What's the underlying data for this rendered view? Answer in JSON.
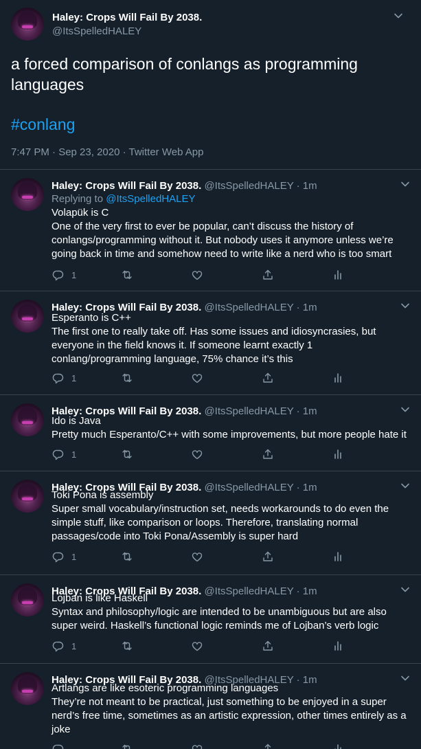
{
  "main_tweet": {
    "name": "Haley: Crops Will Fail By 2038.",
    "handle": "@ItsSpelledHALEY",
    "text": "a forced comparison of conlangs as programming languages",
    "hashtag": "#conlang",
    "meta": "7:47 PM · Sep 23, 2020 · Twitter Web App"
  },
  "replies": [
    {
      "name": "Haley: Crops Will Fail By 2038.",
      "meta": "@ItsSpelledHALEY · 1m",
      "replying_prefix": "Replying to ",
      "replying_to": "@ItsSpelledHALEY",
      "line1": "Volapük is C",
      "line2": "One of the very first to ever be popular, can’t discuss the history of conlangs/programming without it. But nobody uses it anymore unless we’re going back in time and somehow need to write like a nerd who is too smart",
      "reply_count": "1"
    },
    {
      "name": "Haley: Crops Will Fail By 2038.",
      "meta": "@ItsSpelledHALEY · 1m",
      "line1": "Esperanto is C++",
      "line2": "The first one to really take off. Has some issues and idiosyncrasies, but everyone in the field knows it. If someone learnt exactly 1 conlang/programming language, 75% chance it’s this",
      "reply_count": "1"
    },
    {
      "name": "Haley: Crops Will Fail By 2038.",
      "meta": "@ItsSpelledHALEY · 1m",
      "line1": "Ido is Java",
      "line2": "Pretty much Esperanto/C++ with some improvements, but more people hate it",
      "reply_count": "1"
    },
    {
      "name": "Haley: Crops Will Fail By 2038.",
      "meta": "@ItsSpelledHALEY · 1m",
      "line1": "Toki Pona is assembly",
      "line2": "Super small vocabulary/instruction set, needs workarounds to do even the simple stuff, like comparison or loops. Therefore, translating normal passages/code into Toki Pona/Assembly is super hard",
      "reply_count": "1"
    },
    {
      "name": "Haley: Crops Will Fail By 2038.",
      "meta": "@ItsSpelledHALEY · 1m",
      "line1": "Lojban is like Haskell",
      "line2": "Syntax and philosophy/logic are intended to be unambiguous but are also super weird. Haskell’s functional logic reminds me of Lojban’s verb logic",
      "reply_count": "1"
    },
    {
      "name": "Haley: Crops Will Fail By 2038.",
      "meta": "@ItsSpelledHALEY · 1m",
      "line1": "Artlangs are like esoteric programming languages",
      "line2": "They’re not meant to be practical, just something to be enjoyed in a super nerd’s free time, sometimes as an artistic expression, other times entirely as a joke",
      "reply_count": ""
    }
  ],
  "icons": {
    "reply": "reply-icon",
    "retweet": "retweet-icon",
    "like": "heart-icon",
    "share": "share-icon",
    "analytics": "analytics-icon",
    "more": "chevron-down-icon"
  },
  "colors": {
    "background": "#15202b",
    "text": "#ffffff",
    "secondary": "#8899a6",
    "link": "#1da1f2",
    "divider": "#38444d"
  }
}
